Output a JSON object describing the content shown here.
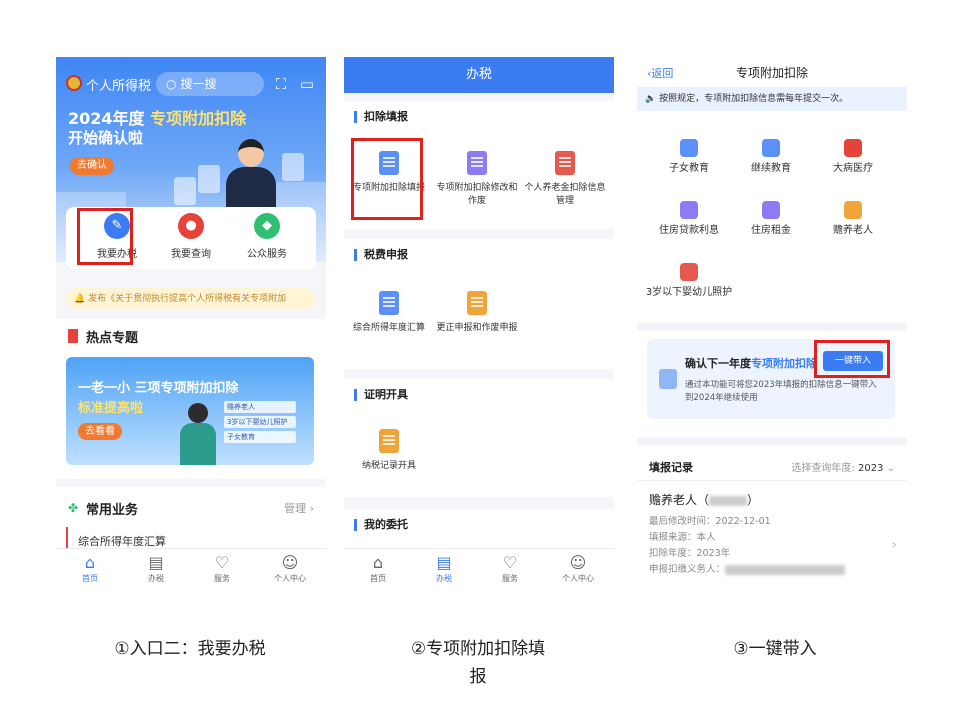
{
  "screen1": {
    "app_title": "个人所得税",
    "search_placeholder": "搜一搜",
    "banner": {
      "year_text": "2024年度",
      "highlight": "专项附加扣除",
      "line2": "开始确认啦",
      "button": "去确认"
    },
    "quick": [
      {
        "label": "我要办税",
        "icon": "pen-icon",
        "color": "#3b7cf2"
      },
      {
        "label": "我要查询",
        "icon": "search-icon",
        "color": "#e5423a"
      },
      {
        "label": "公众服务",
        "icon": "service-icon",
        "color": "#2fbf71"
      }
    ],
    "notice": "发布《关于贯彻执行提高个人所得税有关专项附加",
    "hot": {
      "title": "热点专题",
      "card_line1": "一老一小 三项专项附加扣除",
      "card_line2": "标准提高啦",
      "card_button": "去看看",
      "tags": [
        "赡养老人",
        "3岁以下婴幼儿照护",
        "子女教育"
      ]
    },
    "common": {
      "title": "常用业务",
      "manage": "管理",
      "item": "综合所得年度汇算"
    },
    "tabs": [
      {
        "label": "首页",
        "icon": "home-icon",
        "active": true
      },
      {
        "label": "办税",
        "icon": "document-icon",
        "active": false
      },
      {
        "label": "服务",
        "icon": "heart-icon",
        "active": false
      },
      {
        "label": "个人中心",
        "icon": "user-icon",
        "active": false
      }
    ]
  },
  "screen2": {
    "header": "办税",
    "sections": [
      {
        "title": "扣除填报",
        "items": [
          {
            "label": "专项附加扣除填报",
            "color": "#5b8ff9"
          },
          {
            "label": "专项附加扣除修改和作废",
            "color": "#8b7cf6"
          },
          {
            "label": "个人养老金扣除信息管理",
            "color": "#e5594f"
          }
        ]
      },
      {
        "title": "税费申报",
        "items": [
          {
            "label": "综合所得年度汇算",
            "color": "#5b8ff9"
          },
          {
            "label": "更正申报和作废申报",
            "color": "#f0a53a"
          }
        ]
      },
      {
        "title": "证明开具",
        "items": [
          {
            "label": "纳税记录开具",
            "color": "#f0a53a"
          }
        ]
      },
      {
        "title": "我的委托",
        "items": []
      }
    ],
    "tabs": [
      {
        "label": "首页",
        "icon": "home-icon",
        "active": false
      },
      {
        "label": "办税",
        "icon": "document-icon",
        "active": true
      },
      {
        "label": "服务",
        "icon": "heart-icon",
        "active": false
      },
      {
        "label": "个人中心",
        "icon": "user-icon",
        "active": false
      }
    ]
  },
  "screen3": {
    "back": "返回",
    "title": "专项附加扣除",
    "notice": "按照规定，专项附加扣除信息需每年提交一次。",
    "items": [
      {
        "label": "子女教育",
        "color": "#5b8ff9"
      },
      {
        "label": "继续教育",
        "color": "#5b8ff9"
      },
      {
        "label": "大病医疗",
        "color": "#e5423a"
      },
      {
        "label": "住房贷款利息",
        "color": "#8b7cf6"
      },
      {
        "label": "住房租金",
        "color": "#8b7cf6"
      },
      {
        "label": "赡养老人",
        "color": "#f0a53a"
      },
      {
        "label": "3岁以下婴幼儿照护",
        "color": "#e5594f"
      }
    ],
    "card": {
      "prefix": "确认下一年度",
      "highlight": "专项附加扣除",
      "button": "一键带入",
      "desc": "通过本功能可将您2023年填报的扣除信息一键带入到2024年继续使用"
    },
    "records": {
      "title": "填报记录",
      "year_label": "选择查询年度:",
      "year": "2023",
      "name": "赡养老人（",
      "name_end": "）",
      "modified": "最后修改时间：2022-12-01",
      "source": "填报来源：本人",
      "deduct_year": "扣除年度：2023年",
      "agent": "申报扣缴义务人："
    }
  },
  "captions": [
    "①入口二：我要办税",
    "②专项附加扣除填报",
    "③一键带入"
  ],
  "colors": {
    "brand_blue": "#3b7cf2",
    "highlight_red": "#e0201c"
  }
}
